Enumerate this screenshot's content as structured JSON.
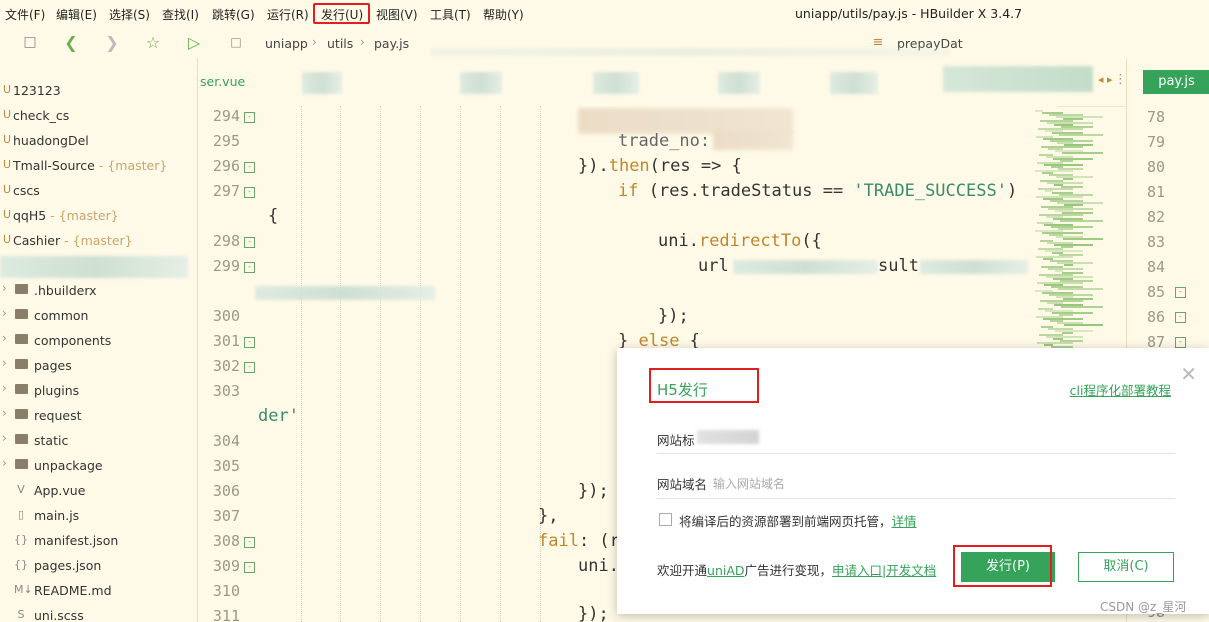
{
  "menu": [
    "文件(F)",
    "编辑(E)",
    "选择(S)",
    "查找(I)",
    "跳转(G)",
    "运行(R)",
    "发行(U)",
    "视图(V)",
    "工具(T)",
    "帮助(Y)"
  ],
  "window_title": "uniapp/utils/pay.js - HBuilder X 3.4.7",
  "breadcrumb": [
    "uniapp",
    "utils",
    "pay.js"
  ],
  "outline_func": "prepayDat",
  "tabs": {
    "left_visible": "ser.vue",
    "right_active": "pay.js"
  },
  "sidebar": {
    "projects": [
      {
        "name": "123123",
        "branch": ""
      },
      {
        "name": "check_cs",
        "branch": ""
      },
      {
        "name": "huadongDel",
        "branch": ""
      },
      {
        "name": "Tmall-Source",
        "branch": "{master}"
      },
      {
        "name": "cscs",
        "branch": ""
      },
      {
        "name": "qqH5",
        "branch": "{master}"
      },
      {
        "name": "Cashier",
        "branch": "{master}"
      }
    ],
    "tree": [
      {
        "name": ".hbuilderx",
        "kind": "folder"
      },
      {
        "name": "common",
        "kind": "folder"
      },
      {
        "name": "components",
        "kind": "folder"
      },
      {
        "name": "pages",
        "kind": "folder"
      },
      {
        "name": "plugins",
        "kind": "folder"
      },
      {
        "name": "request",
        "kind": "folder"
      },
      {
        "name": "static",
        "kind": "folder"
      },
      {
        "name": "unpackage",
        "kind": "folder"
      },
      {
        "name": "App.vue",
        "kind": "vue"
      },
      {
        "name": "main.js",
        "kind": "js"
      },
      {
        "name": "manifest.json",
        "kind": "json"
      },
      {
        "name": "pages.json",
        "kind": "json"
      },
      {
        "name": "README.md",
        "kind": "md"
      },
      {
        "name": "uni.scss",
        "kind": "scss"
      }
    ]
  },
  "editor": {
    "line_numbers": [
      "294",
      "295",
      "296",
      "297",
      "",
      "298",
      "299",
      "",
      "300",
      "301",
      "302",
      "303",
      "",
      "304",
      "305",
      "306",
      "307",
      "308",
      "309",
      "310",
      "311"
    ],
    "code": {
      "l295": "trade_no: ",
      "l296_a": "}).",
      "l296_b": "then",
      "l296_c": "(res => {",
      "l297_kw": "if",
      "l297_a": " (res.tradeStatus == ",
      "l297_str": "'TRADE_SUCCESS'",
      "l297_b": ")",
      "l297_cont": "{",
      "l298_a": "uni.",
      "l298_b": "redirectTo",
      "l298_c": "({",
      "l299": "url",
      "l299_tail": "sult",
      "l300": "});",
      "l301_a": "} ",
      "l301_kw": "else",
      "l301_b": " {",
      "l303_cont": "der'",
      "l306": "});",
      "l307": "},",
      "l308_kw": "fail",
      "l308_b": ": (r",
      "l309": "uni.",
      "l311": "});"
    }
  },
  "right_line_numbers": [
    "78",
    "79",
    "80",
    "81",
    "82",
    "83",
    "84",
    "85",
    "86",
    "87",
    "98"
  ],
  "dialog": {
    "title": "H5发行",
    "top_link": "cli程序化部署教程",
    "site_title_label": "网站标",
    "domain_label": "网站域名",
    "domain_placeholder": "输入网站域名",
    "checkbox_label": "将编译后的资源部署到前端网页托管，",
    "checkbox_link": "详情",
    "ad_prefix": "欢迎开通",
    "ad_link1": "uniAD",
    "ad_middle": "广告进行变现，",
    "ad_link2": "申请入口|开发文档",
    "publish_button": "发行(P)",
    "cancel_button": "取消(C)"
  },
  "watermark": "CSDN @z_星河",
  "colors": {
    "accent": "#35a35a",
    "highlight_box": "#e02020",
    "background": "#fffae8"
  }
}
